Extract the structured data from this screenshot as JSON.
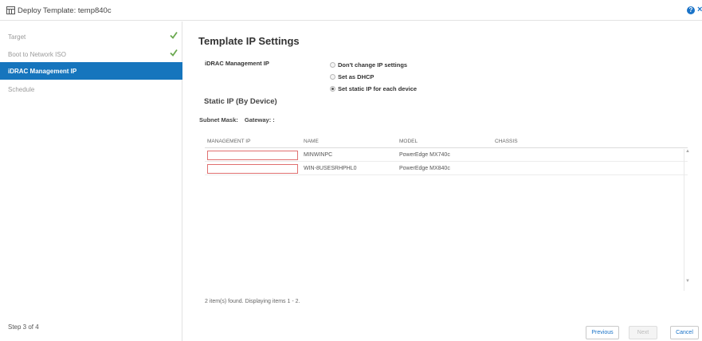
{
  "window": {
    "title": "Deploy Template: temp840c",
    "help_label": "?",
    "close_label": "×"
  },
  "sidebar": {
    "steps": [
      {
        "label": "Target",
        "completed": true
      },
      {
        "label": "Boot to Network ISO",
        "completed": true
      },
      {
        "label": "iDRAC Management IP",
        "active": true
      },
      {
        "label": "Schedule"
      }
    ],
    "step_count": "Step 3 of 4"
  },
  "main": {
    "title": "Template IP Settings",
    "idrac_label": "iDRAC Management IP",
    "ip_options": [
      {
        "label": "Don't change IP settings",
        "checked": false
      },
      {
        "label": "Set as DHCP",
        "checked": false
      },
      {
        "label": "Set static IP for each device",
        "checked": true
      }
    ],
    "static_title": "Static IP (By Device)",
    "subnet_label": "Subnet Mask:",
    "gateway_label": "Gateway: :",
    "grid": {
      "columns": [
        "MANAGEMENT IP",
        "NAME",
        "MODEL",
        "CHASSIS"
      ],
      "rows": [
        {
          "management_ip": "",
          "name": "MINWINPC",
          "model": "PowerEdge MX740c",
          "chassis": ""
        },
        {
          "management_ip": "",
          "name": "WIN-8USESRHPHL0",
          "model": "PowerEdge MX840c",
          "chassis": ""
        }
      ],
      "scroll_up": "▲",
      "scroll_down": "▼"
    },
    "items_found": "2 item(s) found. Displaying items 1 - 2."
  },
  "footer": {
    "previous_label": "Previous",
    "next_label": "Next",
    "cancel_label": "Cancel"
  },
  "colors": {
    "accent": "#1675bd",
    "check_green": "#6aa84f",
    "error_border": "#e07070"
  }
}
